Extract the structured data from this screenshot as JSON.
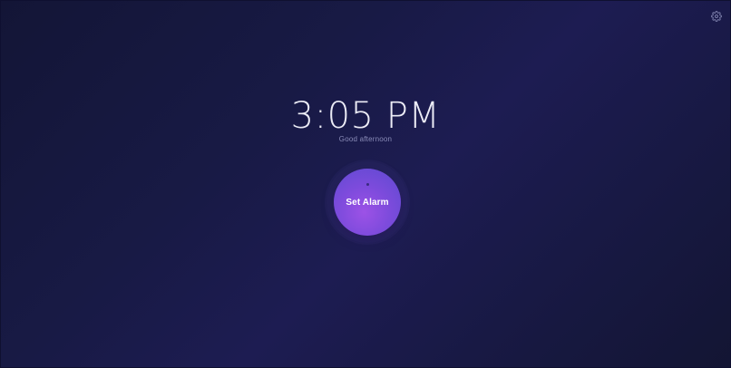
{
  "clock": {
    "time": "3:05 PM",
    "greeting": "Good afternoon"
  },
  "alarm": {
    "label": "Set Alarm"
  },
  "icons": {
    "settings": "gear-icon",
    "alarm_indicator": "dot-icon"
  },
  "colors": {
    "background": "#181a45",
    "accent": "#8b4fe0",
    "text": "#ececf6",
    "muted_text": "#8a8cb8"
  }
}
